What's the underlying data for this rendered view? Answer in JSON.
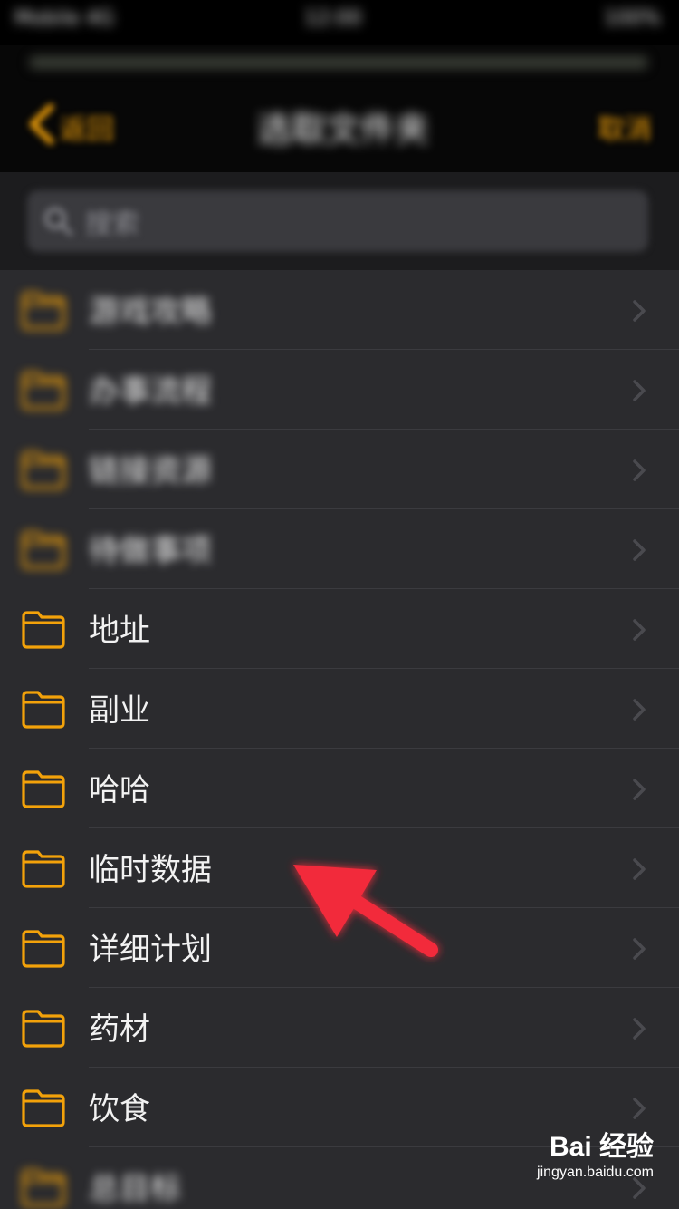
{
  "status": {
    "carrier": "Mobile 4G",
    "time": "12:00",
    "battery": "100%"
  },
  "nav": {
    "back_label": "返回",
    "title": "选取文件夹",
    "right_label": "取消"
  },
  "search": {
    "placeholder": "搜索"
  },
  "folders": [
    {
      "label": "游戏攻略",
      "blurred": true
    },
    {
      "label": "办事流程",
      "blurred": true
    },
    {
      "label": "链接资源",
      "blurred": true
    },
    {
      "label": "待做事项",
      "blurred": true
    },
    {
      "label": "地址"
    },
    {
      "label": "副业"
    },
    {
      "label": "哈哈"
    },
    {
      "label": "临时数据"
    },
    {
      "label": "详细计划"
    },
    {
      "label": "药材"
    },
    {
      "label": "饮食"
    },
    {
      "label": "总目标",
      "blurred": true
    }
  ],
  "watermark": {
    "brand": "Bai 经验",
    "url": "jingyan.baidu.com"
  },
  "colors": {
    "accent": "#F3A20A",
    "background": "#2B2B2E",
    "arrow": "#F22B3B"
  }
}
